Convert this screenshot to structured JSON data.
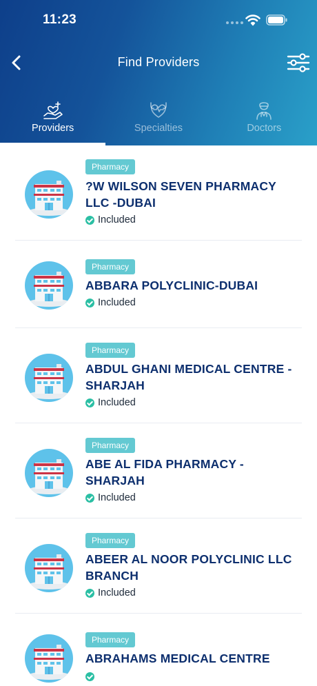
{
  "status_bar": {
    "time": "11:23"
  },
  "navbar": {
    "title": "Find Providers"
  },
  "tabs": [
    {
      "label": "Providers",
      "icon": "heart-hand-icon",
      "active": true
    },
    {
      "label": "Specialties",
      "icon": "heart-stethoscope-icon",
      "active": false
    },
    {
      "label": "Doctors",
      "icon": "doctor-icon",
      "active": false
    }
  ],
  "providers": [
    {
      "category": "Pharmacy",
      "name": "?W WILSON SEVEN PHARMACY LLC -DUBAI",
      "status": "Included"
    },
    {
      "category": "Pharmacy",
      "name": "ABBARA POLYCLINIC-DUBAI",
      "status": "Included"
    },
    {
      "category": "Pharmacy",
      "name": "ABDUL GHANI MEDICAL CENTRE - SHARJAH",
      "status": "Included"
    },
    {
      "category": "Pharmacy",
      "name": "ABE AL FIDA PHARMACY - SHARJAH",
      "status": "Included"
    },
    {
      "category": "Pharmacy",
      "name": "ABEER AL NOOR POLYCLINIC LLC BRANCH",
      "status": "Included"
    },
    {
      "category": "Pharmacy",
      "name": "ABRAHAMS MEDICAL CENTRE",
      "status": ""
    }
  ],
  "colors": {
    "header_start": "#0e3f8a",
    "header_end": "#2aa0c9",
    "badge": "#63c9d2",
    "name_text": "#0d2f6e",
    "check": "#2bbfa4"
  }
}
